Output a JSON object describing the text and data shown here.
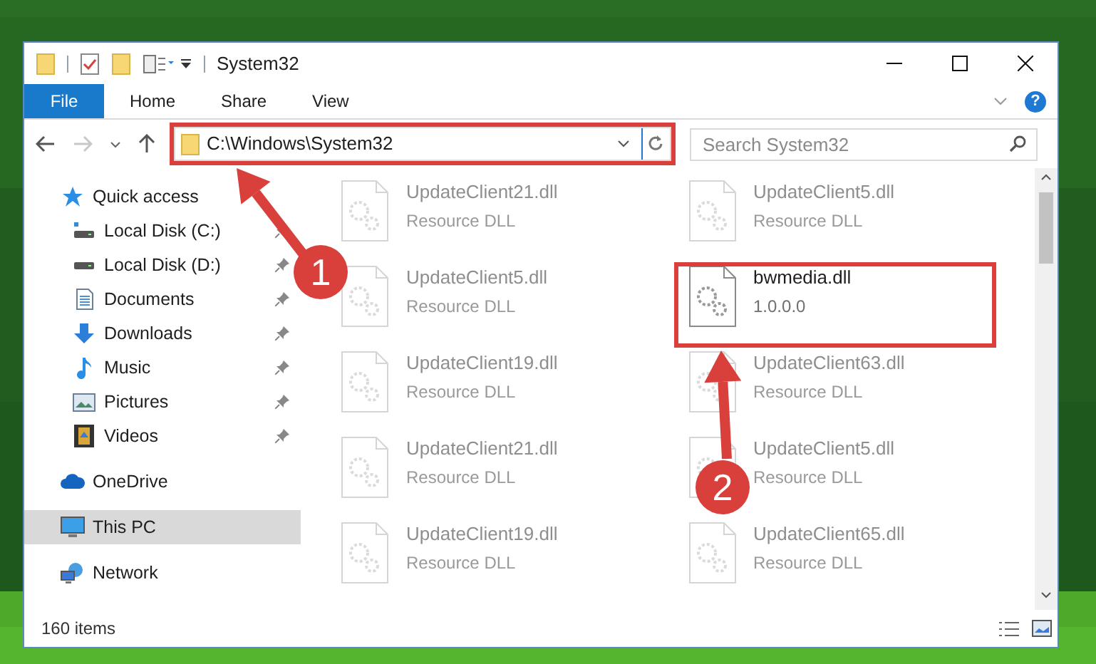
{
  "window": {
    "title": "System32"
  },
  "ribbon": {
    "tabs": [
      {
        "label": "File",
        "kind": "file"
      },
      {
        "label": "Home",
        "kind": "tab"
      },
      {
        "label": "Share",
        "kind": "tab"
      },
      {
        "label": "View",
        "kind": "tab"
      }
    ],
    "help_glyph": "?"
  },
  "navigation": {
    "forward_disabled": true,
    "address": "C:\\Windows\\System32",
    "search": {
      "placeholder": "Search System32"
    }
  },
  "sidebar": {
    "items": [
      {
        "label": "Quick access",
        "selected": false,
        "children": [
          {
            "label": "Local Disk (C:)",
            "pinned": true
          },
          {
            "label": "Local Disk (D:)",
            "pinned": true
          },
          {
            "label": "Documents",
            "pinned": true
          },
          {
            "label": "Downloads",
            "pinned": true
          },
          {
            "label": "Music",
            "pinned": true
          },
          {
            "label": "Pictures",
            "pinned": true
          },
          {
            "label": "Videos",
            "pinned": true
          }
        ]
      },
      {
        "label": "OneDrive",
        "selected": false
      },
      {
        "label": "This PC",
        "selected": true
      },
      {
        "label": "Network",
        "selected": false
      }
    ]
  },
  "files": [
    {
      "name": "UpdateClient21.dll",
      "detail": "Resource DLL",
      "faded": true
    },
    {
      "name": "UpdateClient5.dll",
      "detail": "Resource DLL",
      "faded": true
    },
    {
      "name": "UpdateClient5.dll",
      "detail": "Resource DLL",
      "faded": true
    },
    {
      "name": "bwmedia.dll",
      "detail": "1.0.0.0",
      "faded": false
    },
    {
      "name": "UpdateClient19.dll",
      "detail": "Resource DLL",
      "faded": true
    },
    {
      "name": "UpdateClient63.dll",
      "detail": "Resource DLL",
      "faded": true
    },
    {
      "name": "UpdateClient21.dll",
      "detail": "Resource DLL",
      "faded": true
    },
    {
      "name": "UpdateClient5.dll",
      "detail": "Resource DLL",
      "faded": true
    },
    {
      "name": "UpdateClient19.dll",
      "detail": "Resource DLL",
      "faded": true
    },
    {
      "name": "UpdateClient65.dll",
      "detail": "Resource DLL",
      "faded": true
    }
  ],
  "status_bar": {
    "count": "160 items"
  },
  "annotations": {
    "steps": [
      "1",
      "2"
    ]
  }
}
